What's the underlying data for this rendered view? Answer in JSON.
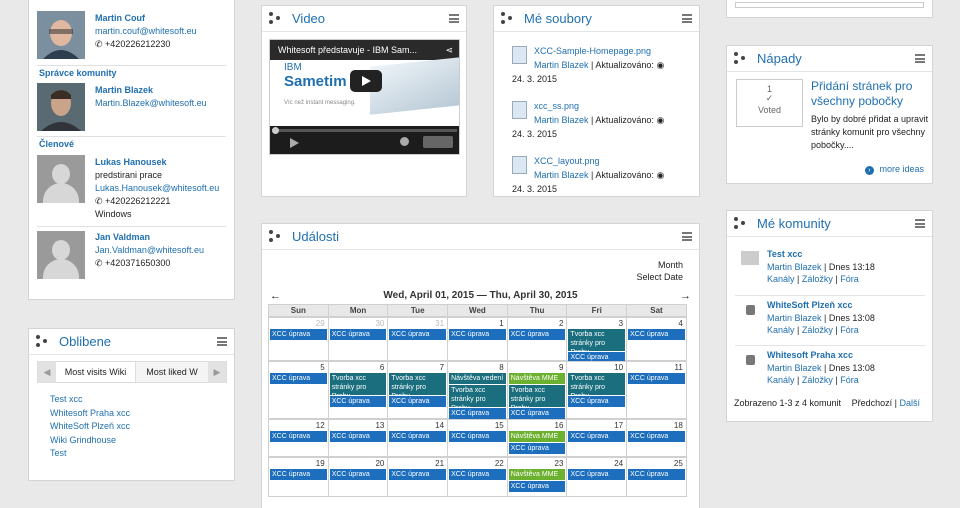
{
  "contacts": {
    "top_person": {
      "name": "Martin Couf",
      "email": "martin.couf@whitesoft.eu",
      "phone": "+420226212230"
    },
    "admin_section": "Správce komunity",
    "admin": {
      "name": "Martin Blazek",
      "email": "Martin.Blazek@whitesoft.eu"
    },
    "members_section": "Členové",
    "members": [
      {
        "name": "Lukas Hanousek",
        "role": "predstirani prace",
        "email": "Lukas.Hanousek@whitesoft.eu",
        "phone": "+420226212221",
        "os": "Windows"
      },
      {
        "name": "Jan Valdman",
        "email": "Jan.Valdman@whitesoft.eu",
        "phone": "+420371650300"
      }
    ]
  },
  "oblibene": {
    "title": "Oblibene",
    "tabs": [
      "Most visits Wiki",
      "Most liked W"
    ],
    "links": [
      "Test xcc",
      "Whitesoft Praha xcc",
      "WhiteSoft Plzeň xcc",
      "Wiki Grindhouse",
      "Test"
    ]
  },
  "video": {
    "title": "Video",
    "video_title": "Whitesoft představuje - IBM Sam...",
    "brand1": "IBM",
    "brand2": "Sametim",
    "tagline": "Víc než instant messaging."
  },
  "files": {
    "title": "Mé soubory",
    "items": [
      {
        "name": "XCC-Sample-Homepage.png",
        "author": "Martin Blazek",
        "updated_label": "Aktualizováno:",
        "date": "24. 3. 2015"
      },
      {
        "name": "xcc_ss.png",
        "author": "Martin Blazek",
        "updated_label": "Aktualizováno:",
        "date": "24. 3. 2015"
      },
      {
        "name": "XCC_layout.png",
        "author": "Martin Blazek",
        "updated_label": "Aktualizováno:",
        "date": "24. 3. 2015"
      }
    ]
  },
  "events": {
    "title": "Události",
    "view_month": "Month",
    "view_select": "Select Date",
    "range": "Wed, April 01, 2015 — Thu, April 30, 2015",
    "day_headers": [
      "Sun",
      "Mon",
      "Tue",
      "Wed",
      "Thu",
      "Fri",
      "Sat"
    ],
    "weeks": [
      {
        "days": [
          {
            "n": "29",
            "other": true,
            "ev": [
              {
                "t": "XCC úprava",
                "c": "blue"
              }
            ]
          },
          {
            "n": "30",
            "other": true,
            "ev": [
              {
                "t": "XCC úprava",
                "c": "blue"
              }
            ]
          },
          {
            "n": "31",
            "other": true,
            "ev": [
              {
                "t": "XCC úprava",
                "c": "blue"
              }
            ]
          },
          {
            "n": "1",
            "ev": [
              {
                "t": "XCC úprava",
                "c": "blue"
              }
            ]
          },
          {
            "n": "2",
            "ev": [
              {
                "t": "XCC úprava",
                "c": "blue"
              }
            ]
          },
          {
            "n": "3",
            "ev": [
              {
                "t": "Tvorba xcc stránky pro Prahu",
                "c": "teal",
                "tall": true
              },
              {
                "t": "XCC úprava",
                "c": "blue"
              }
            ]
          },
          {
            "n": "4",
            "ev": [
              {
                "t": "XCC úprava",
                "c": "blue"
              }
            ]
          }
        ]
      },
      {
        "days": [
          {
            "n": "5",
            "ev": [
              {
                "t": "XCC úprava",
                "c": "blue"
              }
            ]
          },
          {
            "n": "6",
            "ev": [
              {
                "t": "Tvorba xcc stránky pro Prahu",
                "c": "teal",
                "tall": true
              },
              {
                "t": "XCC úprava",
                "c": "blue"
              }
            ]
          },
          {
            "n": "7",
            "ev": [
              {
                "t": "Tvorba xcc stránky pro Prahu",
                "c": "teal",
                "tall": true
              },
              {
                "t": "XCC úprava",
                "c": "blue"
              }
            ]
          },
          {
            "n": "8",
            "ev": [
              {
                "t": "Návštěva vedení",
                "c": "teal"
              },
              {
                "t": "Tvorba xcc stránky pro Prahu",
                "c": "teal",
                "tall": true
              },
              {
                "t": "XCC úprava",
                "c": "blue"
              }
            ]
          },
          {
            "n": "9",
            "ev": [
              {
                "t": "Návštěva MME",
                "c": "green"
              },
              {
                "t": "Tvorba xcc stránky pro Prahu",
                "c": "teal",
                "tall": true
              },
              {
                "t": "XCC úprava",
                "c": "blue"
              }
            ]
          },
          {
            "n": "10",
            "ev": [
              {
                "t": "Tvorba xcc stránky pro Prahu",
                "c": "teal",
                "tall": true
              },
              {
                "t": "XCC úprava",
                "c": "blue"
              }
            ]
          },
          {
            "n": "11",
            "ev": [
              {
                "t": "XCC úprava",
                "c": "blue"
              }
            ]
          }
        ]
      },
      {
        "days": [
          {
            "n": "12",
            "ev": [
              {
                "t": "XCC úprava",
                "c": "blue"
              }
            ]
          },
          {
            "n": "13",
            "ev": [
              {
                "t": "XCC úprava",
                "c": "blue"
              }
            ]
          },
          {
            "n": "14",
            "ev": [
              {
                "t": "XCC úprava",
                "c": "blue"
              }
            ]
          },
          {
            "n": "15",
            "ev": [
              {
                "t": "XCC úprava",
                "c": "blue"
              }
            ]
          },
          {
            "n": "16",
            "ev": [
              {
                "t": "Návštěva MME",
                "c": "green"
              },
              {
                "t": "XCC úprava",
                "c": "blue"
              }
            ]
          },
          {
            "n": "17",
            "ev": [
              {
                "t": "XCC úprava",
                "c": "blue"
              }
            ]
          },
          {
            "n": "18",
            "ev": [
              {
                "t": "XCC úprava",
                "c": "blue"
              }
            ]
          }
        ]
      },
      {
        "days": [
          {
            "n": "19",
            "ev": [
              {
                "t": "XCC úprava",
                "c": "blue"
              }
            ]
          },
          {
            "n": "20",
            "ev": [
              {
                "t": "XCC úprava",
                "c": "blue"
              }
            ]
          },
          {
            "n": "21",
            "ev": [
              {
                "t": "XCC úprava",
                "c": "blue"
              }
            ]
          },
          {
            "n": "22",
            "ev": [
              {
                "t": "XCC úprava",
                "c": "blue"
              }
            ]
          },
          {
            "n": "23",
            "ev": [
              {
                "t": "Návštěva MME",
                "c": "green"
              },
              {
                "t": "XCC úprava",
                "c": "blue"
              }
            ]
          },
          {
            "n": "24",
            "ev": [
              {
                "t": "XCC úprava",
                "c": "blue"
              }
            ]
          },
          {
            "n": "25",
            "ev": [
              {
                "t": "XCC úprava",
                "c": "blue"
              }
            ]
          }
        ]
      }
    ]
  },
  "ideas": {
    "title": "Nápady",
    "votes": "1",
    "voted_label": "Voted",
    "idea_title": "Přidání stránek pro všechny pobočky",
    "idea_text": "Bylo by dobré přidat a upravit stránky komunit pro všechny pobočky....",
    "more": "more ideas"
  },
  "communities": {
    "title": "Mé komunity",
    "items": [
      {
        "name": "Test xcc",
        "author": "Martin Blazek",
        "time": "Dnes 13:18",
        "links": [
          "Kanály",
          "Záložky",
          "Fóra"
        ]
      },
      {
        "name": "WhiteSoft Plzeň xcc",
        "author": "Martin Blazek",
        "time": "Dnes 13:08",
        "links": [
          "Kanály",
          "Záložky",
          "Fóra"
        ]
      },
      {
        "name": "Whitesoft Praha xcc",
        "author": "Martin Blazek",
        "time": "Dnes 13:08",
        "links": [
          "Kanály",
          "Záložky",
          "Fóra"
        ]
      }
    ],
    "paging": "Zobrazeno 1-3 z 4 komunit",
    "prev": "Předchozí",
    "next": "Další"
  }
}
